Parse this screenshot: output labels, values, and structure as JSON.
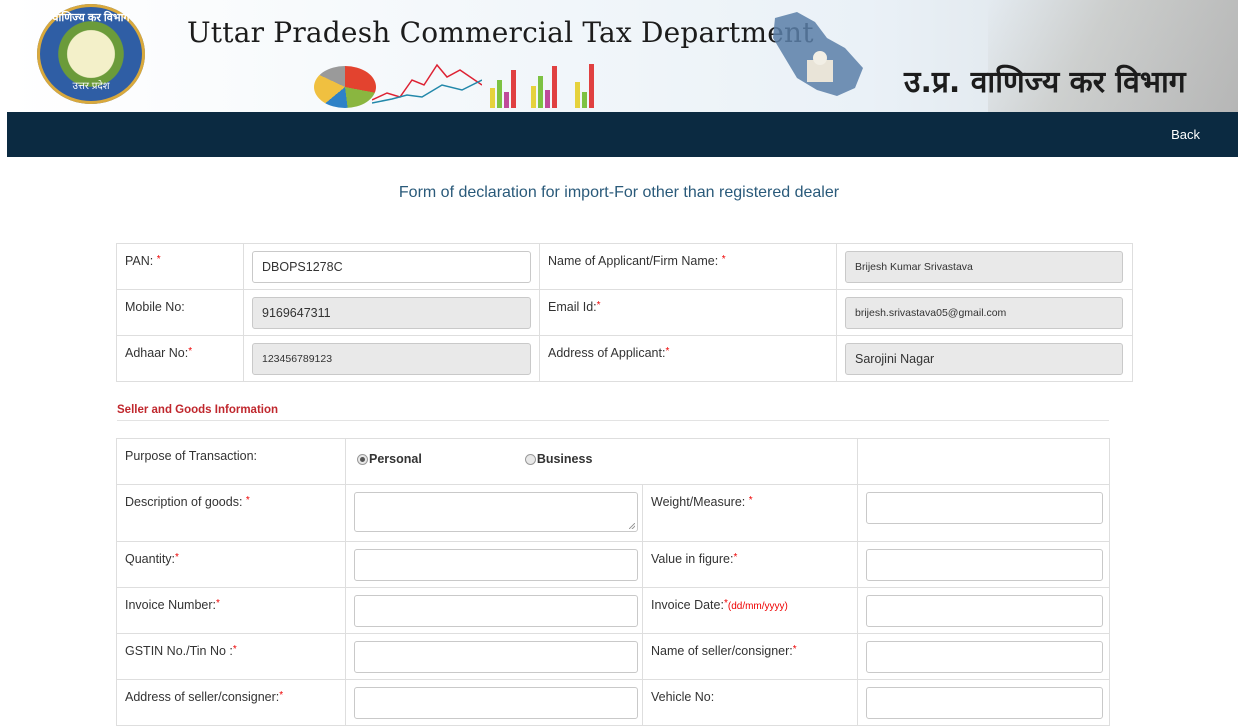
{
  "header": {
    "title_en": "Uttar Pradesh Commercial Tax Department",
    "title_hi": "उ.प्र. वाणिज्य कर विभाग",
    "emblem_text": "वाणिज्य कर विभाग",
    "emblem_bottom": "उत्तर प्रदेश"
  },
  "nav": {
    "back_label": "Back"
  },
  "form_heading": "Form of declaration for import-For other than registered dealer",
  "applicant": {
    "pan_label": "PAN:",
    "pan_value": "DBOPS1278C",
    "name_label": "Name of Applicant/Firm Name:",
    "name_value": "Brijesh Kumar Srivastava",
    "mobile_label": "Mobile No:",
    "mobile_value": "9169647311",
    "email_label": "Email Id:",
    "email_value": "brijesh.srivastava05@gmail.com",
    "aadhaar_label": "Adhaar No:",
    "aadhaar_value": "123456789123",
    "address_label": "Address of Applicant:",
    "address_value": "Sarojini Nagar"
  },
  "section_title": "Seller and Goods Information",
  "goods": {
    "purpose_label": "Purpose of Transaction:",
    "purpose_options": [
      "Personal",
      "Business"
    ],
    "purpose_selected": "Personal",
    "description_label": "Description of goods:",
    "weight_label": "Weight/Measure:",
    "quantity_label": "Quantity:",
    "value_label": "Value in figure:",
    "invoice_number_label": "Invoice Number:",
    "invoice_date_label": "Invoice Date:",
    "invoice_date_hint": "(dd/mm/yyyy)",
    "gstin_label": "GSTIN No./Tin No :",
    "seller_name_label": "Name of seller/consigner:",
    "seller_address_label": "Address of seller/consigner:",
    "vehicle_label": "Vehicle No:"
  },
  "required_marker": "*",
  "colors": {
    "navbar": "#0b2a41",
    "required": "#e00000",
    "section_title": "#c0272d",
    "heading": "#2a5a7a"
  }
}
